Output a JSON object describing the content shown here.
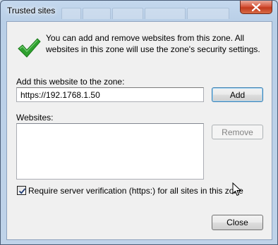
{
  "window": {
    "title": "Trusted sites",
    "close_icon": "close-icon"
  },
  "info": {
    "icon": "checkmark-icon",
    "text": "You can add and remove websites from this zone. All websites in this zone will use the zone's security settings."
  },
  "add_section": {
    "label": "Add this website to the zone:",
    "input_value": "https://192.1768.1.50",
    "add_label": "Add"
  },
  "websites": {
    "label": "Websites:",
    "items": [],
    "remove_label": "Remove"
  },
  "verification": {
    "label": "Require server verification (https:) for all sites in this zone",
    "checked": true
  },
  "footer": {
    "close_label": "Close"
  },
  "colors": {
    "check_green": "#2fa12f",
    "close_red": "#c23a1e",
    "default_button_border": "#3c7fb1"
  }
}
